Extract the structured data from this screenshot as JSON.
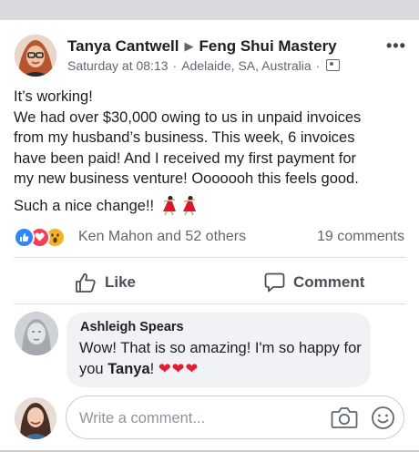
{
  "post": {
    "author": "Tanya Cantwell",
    "group": "Feng Shui Mastery",
    "arrow": "▶",
    "timestamp": "Saturday at 08:13",
    "location": "Adelaide, SA, Australia",
    "dot": "·",
    "more": "•••",
    "lines": [
      "It’s working!",
      "We had over $30,000 owing to us in unpaid invoices",
      "from my husband’s business. This week, 6 invoices",
      "have been paid! And I received my first payment for",
      "my new business venture! Ooooooh this feels good."
    ],
    "last_line": "Such a nice change!!"
  },
  "reactions": {
    "summary": "Ken Mahon and 52 others",
    "comments": "19 comments",
    "icons": [
      "like-icon",
      "love-icon",
      "wow-icon"
    ]
  },
  "actions": {
    "like": "Like",
    "comment": "Comment"
  },
  "comment": {
    "name": "Ashleigh Spears",
    "text_before": "Wow! That is so amazing! I'm so happy for you ",
    "mention": "Tanya",
    "text_after": "!",
    "hearts": "❤❤❤"
  },
  "composer": {
    "placeholder": "Write a comment..."
  },
  "colors": {
    "like_blue": "#2d88ff",
    "love_red": "#f33e58",
    "wow_yellow": "#f7b125",
    "text_primary": "#1c1e21",
    "text_secondary": "#606770"
  }
}
